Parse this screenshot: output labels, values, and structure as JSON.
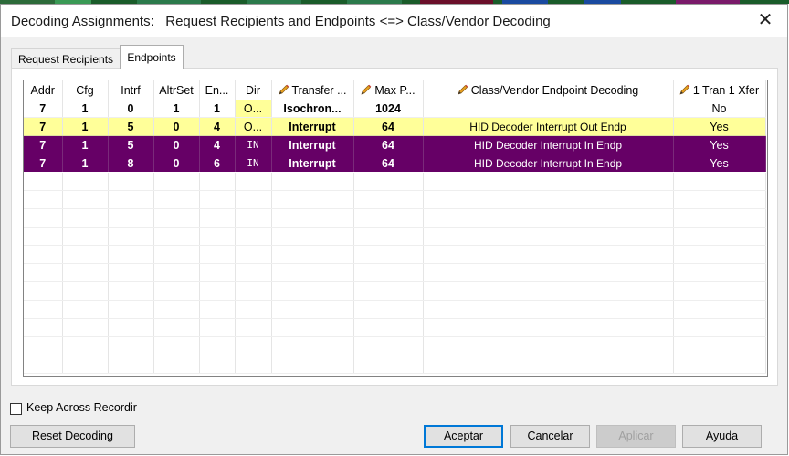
{
  "window": {
    "title": "Decoding Assignments:   Request Recipients and Endpoints <=> Class/Vendor Decoding"
  },
  "tabs": [
    {
      "label": "Request Recipients",
      "active": false
    },
    {
      "label": "Endpoints",
      "active": true
    }
  ],
  "grid": {
    "columns": [
      {
        "label": "Addr",
        "editable": false
      },
      {
        "label": "Cfg",
        "editable": false
      },
      {
        "label": "Intrf",
        "editable": false
      },
      {
        "label": "AltrSet",
        "editable": false
      },
      {
        "label": "En...",
        "editable": false
      },
      {
        "label": "Dir",
        "editable": false
      },
      {
        "label": "Transfer ...",
        "editable": true
      },
      {
        "label": "Max P...",
        "editable": true
      },
      {
        "label": "Class/Vendor Endpoint Decoding",
        "editable": true
      },
      {
        "label": "1 Tran 1 Xfer",
        "editable": true
      }
    ],
    "rows": [
      {
        "style": "white",
        "cells": [
          "7",
          "1",
          "0",
          "1",
          "1",
          "O...",
          "Isochron...",
          "1024",
          "",
          "No"
        ]
      },
      {
        "style": "yellow",
        "cells": [
          "7",
          "1",
          "5",
          "0",
          "4",
          "O...",
          "Interrupt",
          "64",
          "HID Decoder Interrupt Out Endp",
          "Yes"
        ]
      },
      {
        "style": "purple",
        "cells": [
          "7",
          "1",
          "5",
          "0",
          "4",
          "IN",
          "Interrupt",
          "64",
          "HID Decoder Interrupt In Endp",
          "Yes"
        ]
      },
      {
        "style": "purple",
        "cells": [
          "7",
          "1",
          "8",
          "0",
          "6",
          "IN",
          "Interrupt",
          "64",
          "HID Decoder Interrupt In Endp",
          "Yes"
        ]
      }
    ]
  },
  "options": {
    "keep_across_label": "Keep Across Recordir",
    "keep_across_checked": false
  },
  "buttons": {
    "reset": "Reset Decoding",
    "accept": "Aceptar",
    "cancel": "Cancelar",
    "apply": "Aplicar",
    "help": "Ayuda"
  },
  "colors": {
    "selected_row": "#ffff99",
    "decoded_row": "#660066",
    "accent": "#0078d7"
  }
}
